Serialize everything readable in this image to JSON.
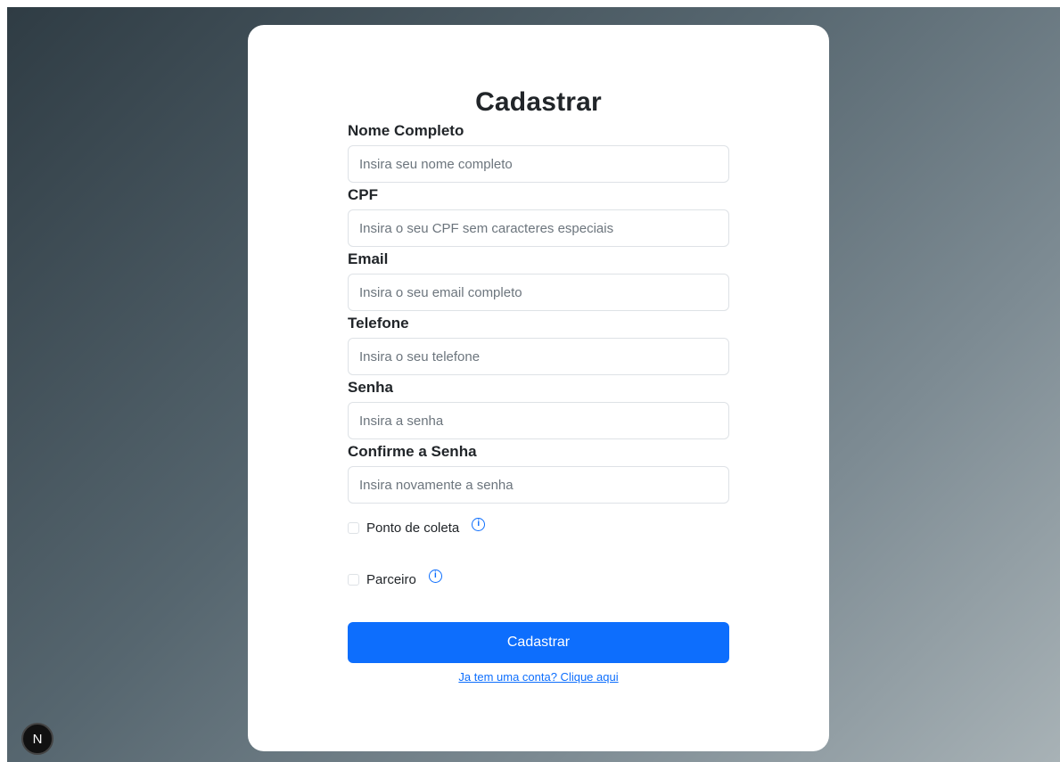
{
  "form": {
    "title": "Cadastrar",
    "fields": [
      {
        "label": "Nome Completo",
        "placeholder": "Insira seu nome completo",
        "value": ""
      },
      {
        "label": "CPF",
        "placeholder": "Insira o seu CPF sem caracteres especiais",
        "value": ""
      },
      {
        "label": "Email",
        "placeholder": "Insira o seu email completo",
        "value": ""
      },
      {
        "label": "Telefone",
        "placeholder": "Insira o seu telefone",
        "value": ""
      },
      {
        "label": "Senha",
        "placeholder": "Insira a senha",
        "value": ""
      },
      {
        "label": "Confirme a Senha",
        "placeholder": "Insira novamente a senha",
        "value": ""
      }
    ],
    "checkboxes": [
      {
        "label": "Ponto de coleta",
        "checked": false,
        "icon": "info-icon"
      },
      {
        "label": "Parceiro",
        "checked": false,
        "icon": "info-icon"
      }
    ],
    "submit_label": "Cadastrar",
    "login_link": "Ja tem uma conta? Clique aqui"
  },
  "devtools": {
    "badge_letter": "N"
  },
  "colors": {
    "accent": "#0d6efd",
    "text": "#212529",
    "placeholder": "#6c757d",
    "border": "#dee2e6"
  }
}
